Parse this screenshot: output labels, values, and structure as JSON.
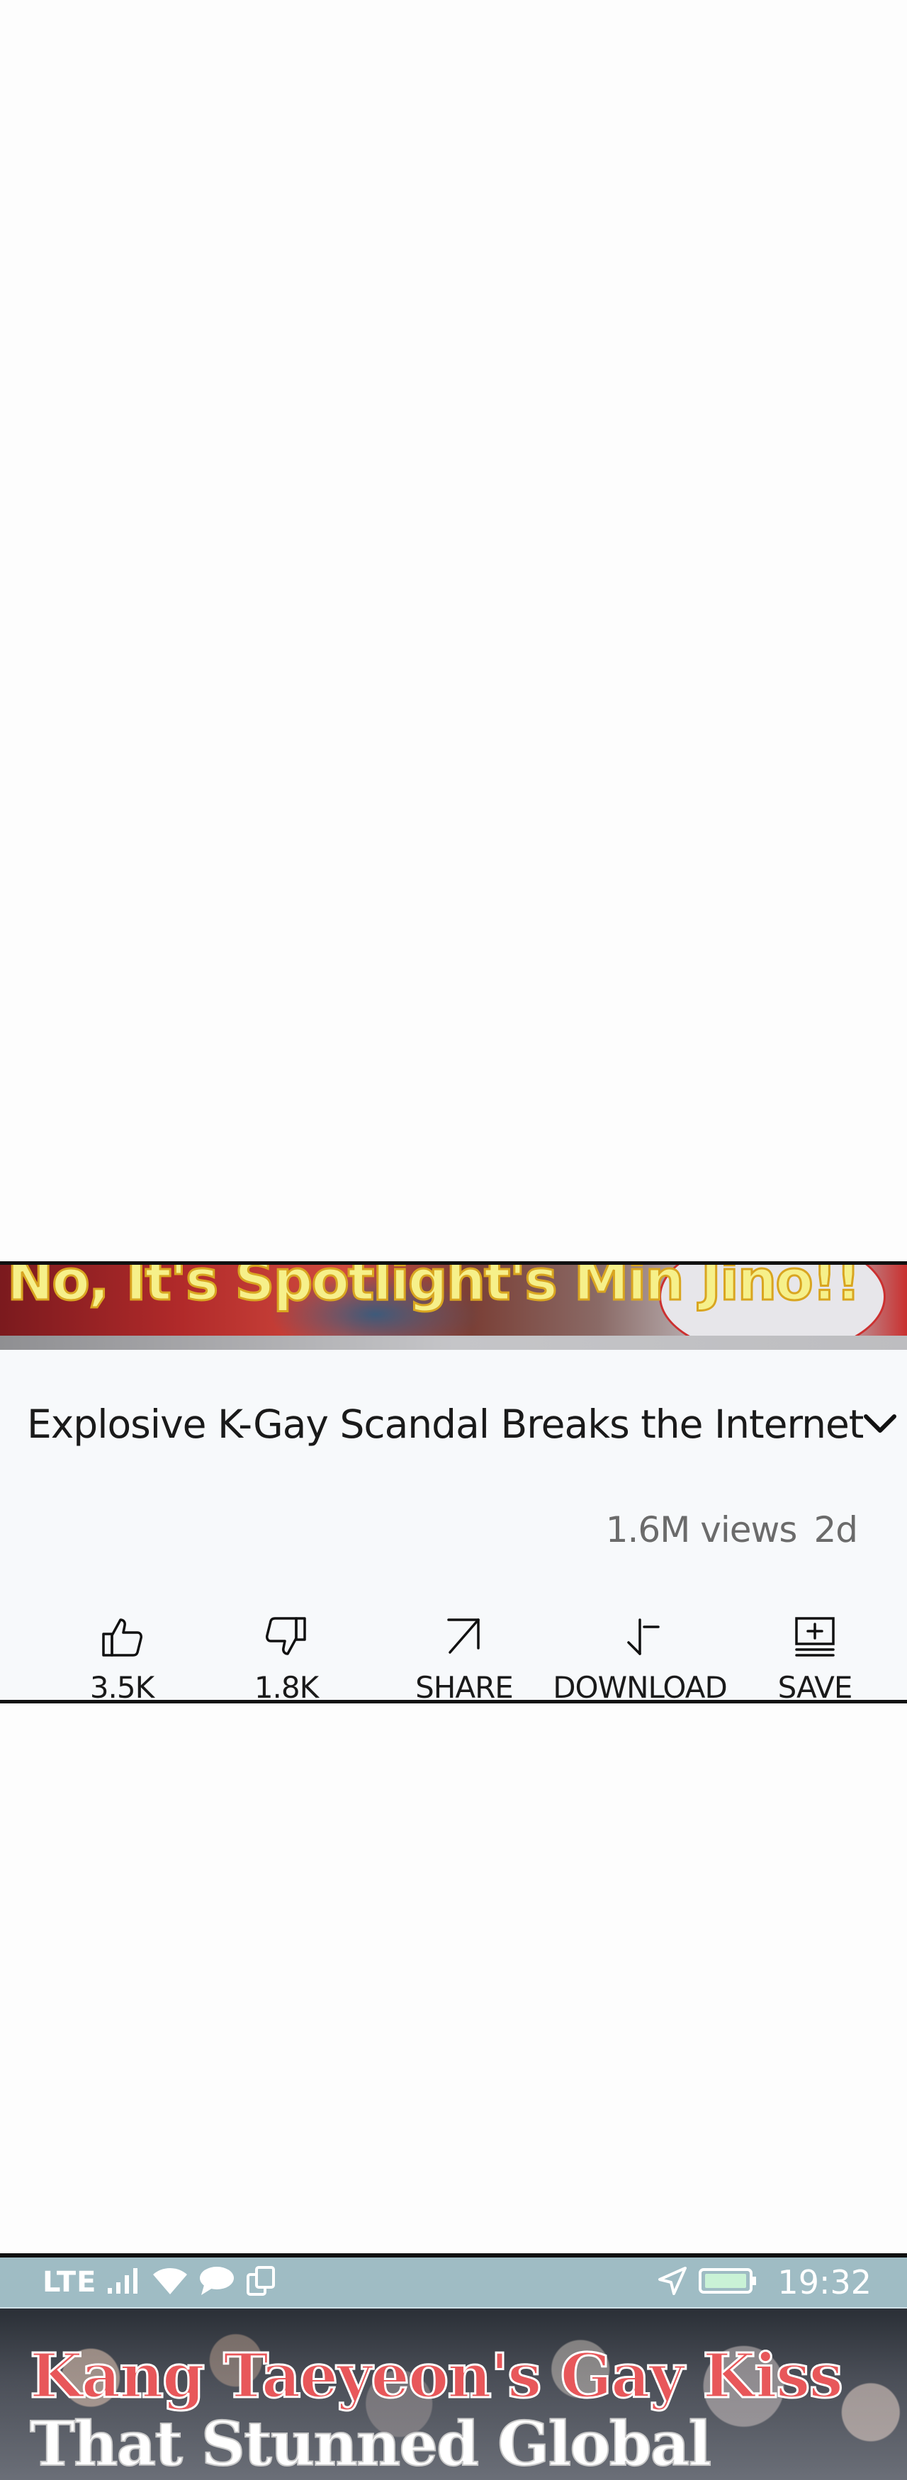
{
  "video": {
    "thumbnail_caption": "No, It's Spotlight's Min Jino!!",
    "title": "Explosive K-Gay Scandal Breaks the Internet",
    "views": "1.6M views",
    "age": "2d"
  },
  "actions": [
    {
      "icon": "thumbs-up-icon",
      "label": "3.5K"
    },
    {
      "icon": "thumbs-down-icon",
      "label": "1.8K"
    },
    {
      "icon": "share-icon",
      "label": "SHARE"
    },
    {
      "icon": "download-icon",
      "label": "DOWNLOAD"
    },
    {
      "icon": "save-icon",
      "label": "SAVE"
    }
  ],
  "status_bar": {
    "network": "LTE",
    "time": "19:32",
    "icons": [
      "signal-icon",
      "wifi-icon",
      "message-icon",
      "sync-icon",
      "location-icon",
      "battery-icon"
    ]
  },
  "next_video": {
    "caption_line1": "Kang Taeyeon's Gay Kiss",
    "caption_line2": "That Stunned Global"
  },
  "colors": {
    "caption_yellow": "#f6f08a",
    "caption_red": "#e8575a",
    "status_bar_bg": "#9fbcc4",
    "card_bg": "#f7f9fb"
  }
}
